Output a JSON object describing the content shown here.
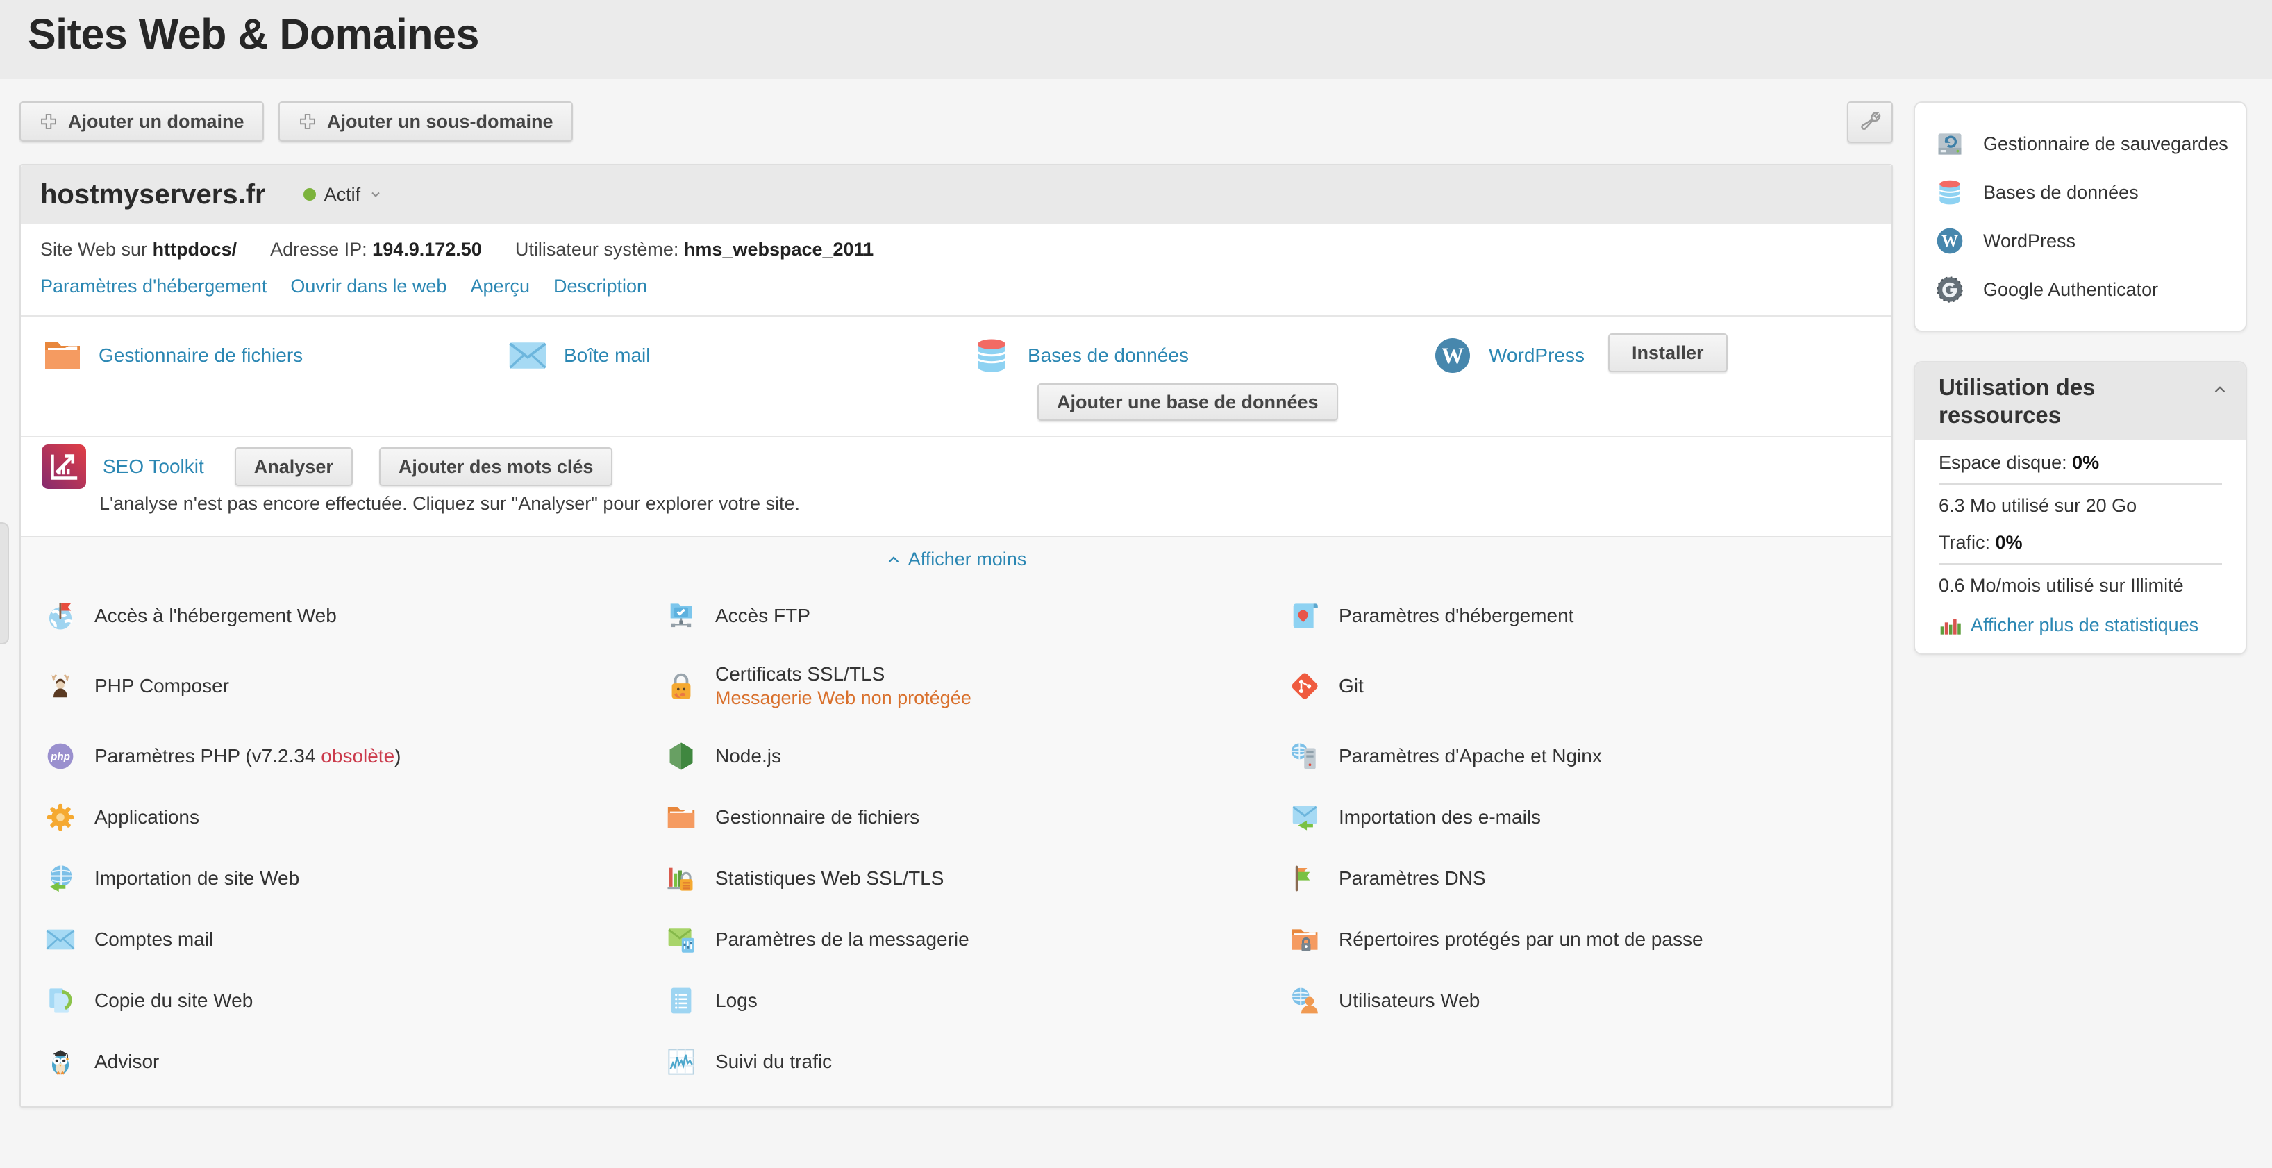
{
  "page_title": "Sites Web & Domaines",
  "toolbar": {
    "add_domain": "Ajouter un domaine",
    "add_subdomain": "Ajouter un sous-domaine",
    "plus_icon": "plus-icon",
    "tools_icon": "wrench-icon"
  },
  "domain": {
    "name": "hostmyservers.fr",
    "status": "Actif",
    "status_color": "#7cb33c",
    "status_chevron": "chevron-down-icon",
    "info": {
      "web_label": "Site Web sur",
      "web_link": "httpdocs/",
      "ip_label": "Adresse IP:",
      "ip_value": "194.9.172.50",
      "user_label": "Utilisateur système:",
      "user_value": "hms_webspace_2011"
    },
    "links": [
      "Paramètres d'hébergement",
      "Ouvrir dans le web",
      "Aperçu",
      "Description"
    ],
    "features": [
      {
        "icon": "file-manager-icon",
        "label": "Gestionnaire de fichiers"
      },
      {
        "icon": "mailbox-icon",
        "label": "Boîte mail"
      },
      {
        "icon": "database-icon",
        "label": "Bases de données",
        "button": "Ajouter une base de données"
      },
      {
        "icon": "wordpress-icon",
        "label": "WordPress",
        "button": "Installer"
      }
    ],
    "seo": {
      "icon": "seo-icon",
      "label": "SEO Toolkit",
      "analyze_button": "Analyser",
      "keywords_button": "Ajouter des mots clés",
      "note": "L'analyse n'est pas encore effectuée. Cliquez sur \"Analyser\" pour explorer votre site."
    },
    "show_less": "Afficher moins",
    "show_less_icon": "chevron-up-icon",
    "grid_rows": [
      [
        {
          "icon": "globe-flag-icon",
          "label": "Accès à l'hébergement Web"
        },
        {
          "icon": "ftp-icon",
          "label": "Accès FTP"
        },
        {
          "icon": "hosting-settings-icon",
          "label": "Paramètres d'hébergement"
        }
      ],
      [
        {
          "icon": "composer-icon",
          "label": "PHP Composer"
        },
        {
          "icon": "ssl-lock-icon",
          "label": "Certificats SSL/TLS",
          "warning": "Messagerie Web non protégée"
        },
        {
          "icon": "git-icon",
          "label": "Git"
        }
      ],
      [
        {
          "icon": "php-icon",
          "label": "Paramètres PHP (v7.2.34 ",
          "alert": "obsolète",
          "suffix": ")"
        },
        {
          "icon": "nodejs-icon",
          "label": "Node.js"
        },
        {
          "icon": "apache-nginx-icon",
          "label": "Paramètres d'Apache et Nginx"
        }
      ],
      [
        {
          "icon": "gear-icon",
          "label": "Applications"
        },
        {
          "icon": "file-manager-icon",
          "label": "Gestionnaire de fichiers"
        },
        {
          "icon": "mail-import-icon",
          "label": "Importation des e-mails"
        }
      ],
      [
        {
          "icon": "site-import-icon",
          "label": "Importation de site Web"
        },
        {
          "icon": "stats-ssl-icon",
          "label": "Statistiques Web SSL/TLS"
        },
        {
          "icon": "dns-icon",
          "label": "Paramètres DNS"
        }
      ],
      [
        {
          "icon": "mailbox-icon",
          "label": "Comptes mail"
        },
        {
          "icon": "mail-settings-icon",
          "label": "Paramètres de la messagerie"
        },
        {
          "icon": "protected-dir-icon",
          "label": "Répertoires protégés par un mot de passe"
        }
      ],
      [
        {
          "icon": "copy-site-icon",
          "label": "Copie du site Web"
        },
        {
          "icon": "logs-icon",
          "label": "Logs"
        },
        {
          "icon": "web-users-icon",
          "label": "Utilisateurs Web"
        }
      ],
      [
        {
          "icon": "advisor-icon",
          "label": "Advisor"
        },
        {
          "icon": "traffic-icon",
          "label": "Suivi du trafic"
        },
        null
      ]
    ]
  },
  "sidebar": {
    "shortcuts": [
      {
        "icon": "backup-icon",
        "label": "Gestionnaire de sauvegardes"
      },
      {
        "icon": "database-icon",
        "label": "Bases de données"
      },
      {
        "icon": "wordpress-icon",
        "label": "WordPress"
      },
      {
        "icon": "gauth-icon",
        "label": "Google Authenticator"
      }
    ],
    "resources": {
      "title": "Utilisation des ressources",
      "collapse_icon": "chevron-up-icon",
      "disk_label": "Espace disque:",
      "disk_value": "0%",
      "disk_detail": "6.3 Mo utilisé sur 20 Go",
      "traffic_label": "Trafic:",
      "traffic_value": "0%",
      "traffic_detail": "0.6 Mo/mois utilisé sur Illimité",
      "stats_icon": "stats-bars-icon",
      "more_stats": "Afficher plus de statistiques"
    }
  }
}
